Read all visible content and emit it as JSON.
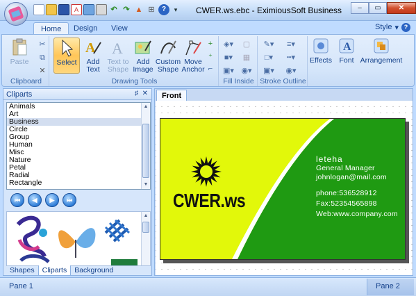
{
  "window": {
    "title": "CWER.ws.ebc - EximiousSoft Business Card Desi...",
    "controls": {
      "minimize": "‒",
      "maximize": "▭",
      "close": "✕"
    }
  },
  "quick_access": {
    "icons": [
      "new-icon",
      "open-icon",
      "save-icon",
      "pdf-icon",
      "image-icon",
      "print-icon",
      "undo-icon",
      "redo-icon",
      "brush-icon",
      "cart-icon",
      "help-icon"
    ],
    "customize": "▾"
  },
  "ribbon": {
    "tabs": [
      "Home",
      "Design",
      "View"
    ],
    "active_tab": "Home",
    "style_label": "Style",
    "groups": {
      "clipboard": {
        "label": "Clipboard",
        "paste": "Paste"
      },
      "drawing_tools": {
        "label": "Drawing Tools",
        "select": "Select",
        "add_text_1": "Add",
        "add_text_2": "Text",
        "text_shape_1": "Text to",
        "text_shape_2": "Shape",
        "add_image_1": "Add",
        "add_image_2": "Image",
        "custom_shape_1": "Custom",
        "custom_shape_2": "Shape",
        "move_anchor_1": "Move",
        "move_anchor_2": "Anchor"
      },
      "fill_inside": {
        "label": "Fill Inside"
      },
      "stroke_outline": {
        "label": "Stroke Outline"
      },
      "effects": "Effects",
      "font": "Font",
      "arrangement": "Arrangement"
    }
  },
  "left_panel": {
    "title": "Cliparts",
    "pin": "♯",
    "close": "✕",
    "categories": [
      "Animals",
      "Art",
      "Business",
      "Circle",
      "Group",
      "Human",
      "Misc",
      "Nature",
      "Petal",
      "Radial",
      "Rectangle"
    ],
    "selected_category": "Business",
    "nav": [
      "⏮",
      "◀",
      "▶",
      "⏭"
    ],
    "bottom_tabs": [
      "Shapes",
      "Cliparts",
      "Background"
    ],
    "active_bottom_tab": "Cliparts"
  },
  "document": {
    "tab": "Front",
    "card": {
      "logo_text": "CWER.ws",
      "name": "leteha",
      "job_title": "General Manager",
      "email": "johnlogan@mail.com",
      "phone": "phone:536528912",
      "fax": "Fax:52354565898",
      "web": "Web:www.company.com",
      "colors": {
        "lime": "#e2f80a",
        "green": "#1f9a12",
        "swoosh": "#ffffff"
      }
    }
  },
  "statusbar": {
    "pane1": "Pane 1",
    "pane2": "Pane 2"
  }
}
